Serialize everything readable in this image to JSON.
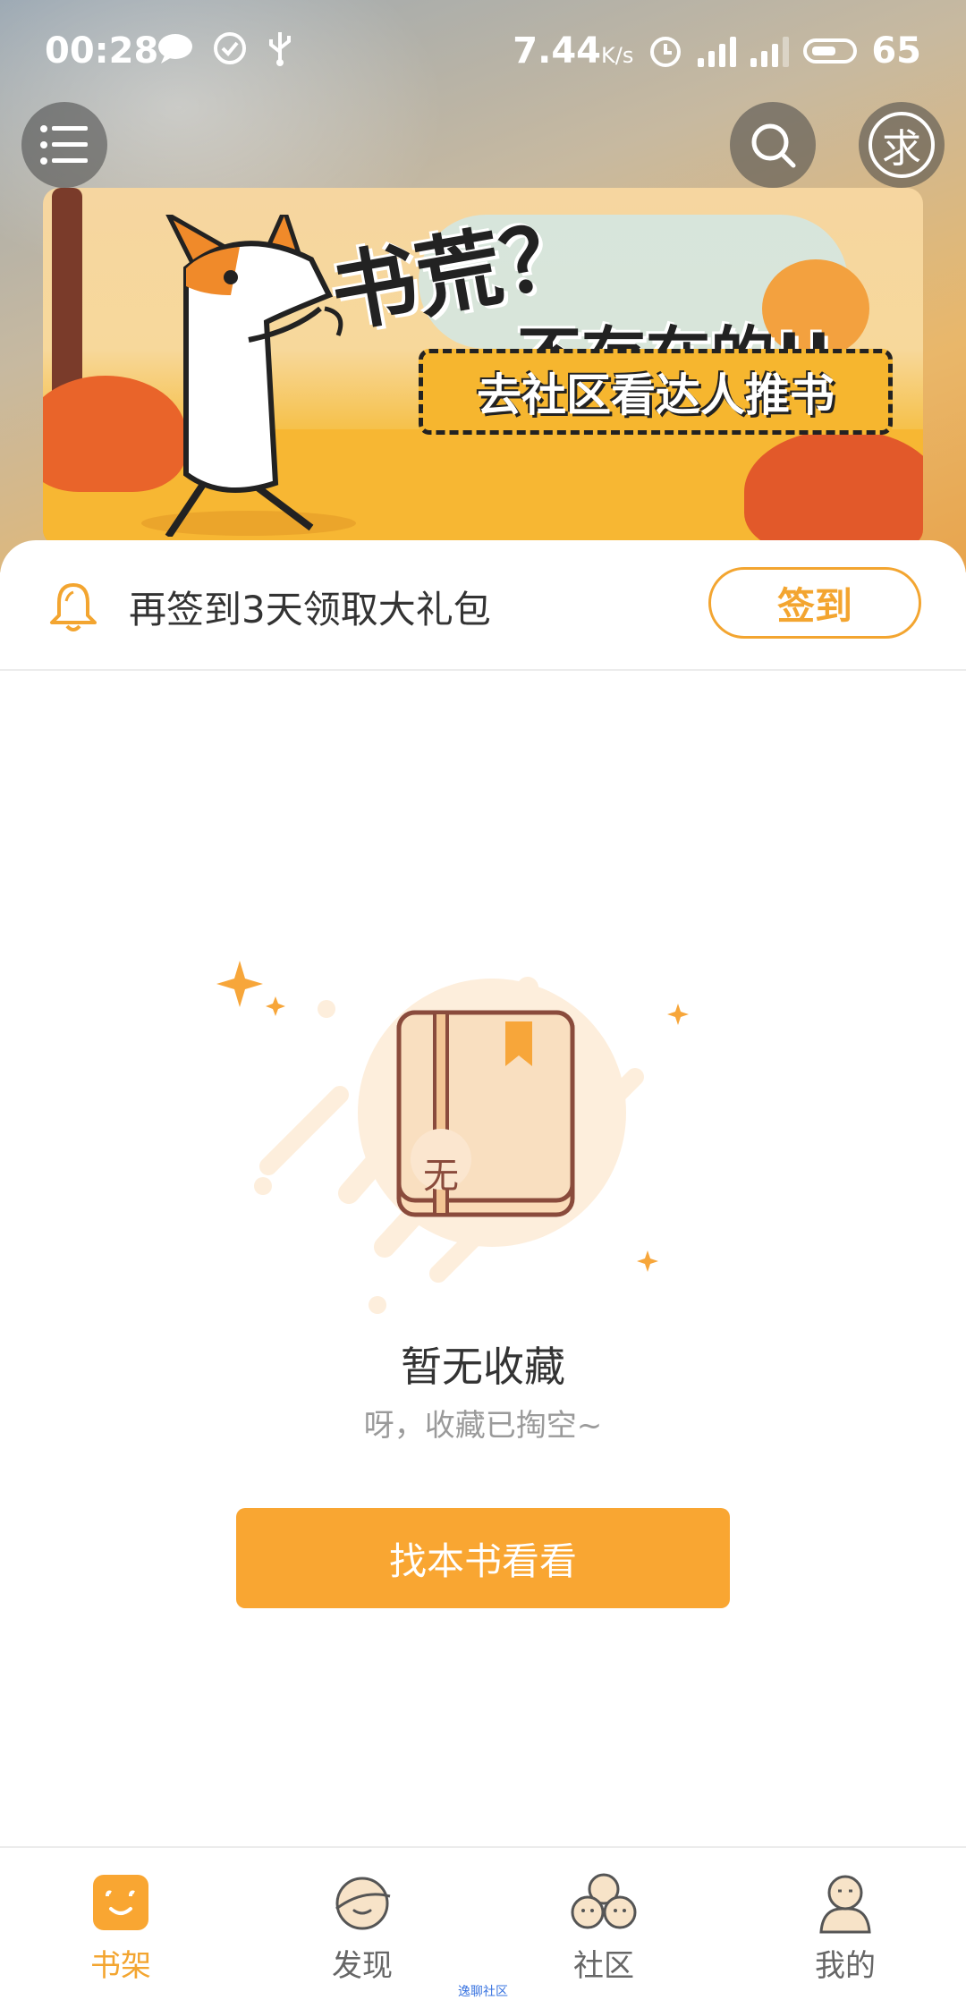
{
  "status_bar": {
    "time": "00:28",
    "speed_value": "7.44",
    "speed_unit": "K/s",
    "network_1": "4G",
    "network_2": "4G",
    "battery": "65"
  },
  "header": {
    "ask_glyph": "求"
  },
  "banner": {
    "headline_1": "书荒？",
    "headline_2": "不存在的!!",
    "cta": "去社区看达人推书"
  },
  "signin": {
    "text": "再签到3天领取大礼包",
    "button": "签到"
  },
  "empty_state": {
    "badge": "无",
    "title": "暂无收藏",
    "subtitle": "呀，收藏已掏空~",
    "button": "找本书看看"
  },
  "bottom_nav": {
    "items": [
      {
        "label": "书架",
        "icon": "bookshelf-icon",
        "active": true
      },
      {
        "label": "发现",
        "icon": "discover-icon",
        "active": false
      },
      {
        "label": "社区",
        "icon": "community-icon",
        "active": false
      },
      {
        "label": "我的",
        "icon": "profile-icon",
        "active": false
      }
    ],
    "tiny_label": "逸聊社区"
  },
  "colors": {
    "accent": "#f3a530",
    "button": "#f9a632"
  }
}
